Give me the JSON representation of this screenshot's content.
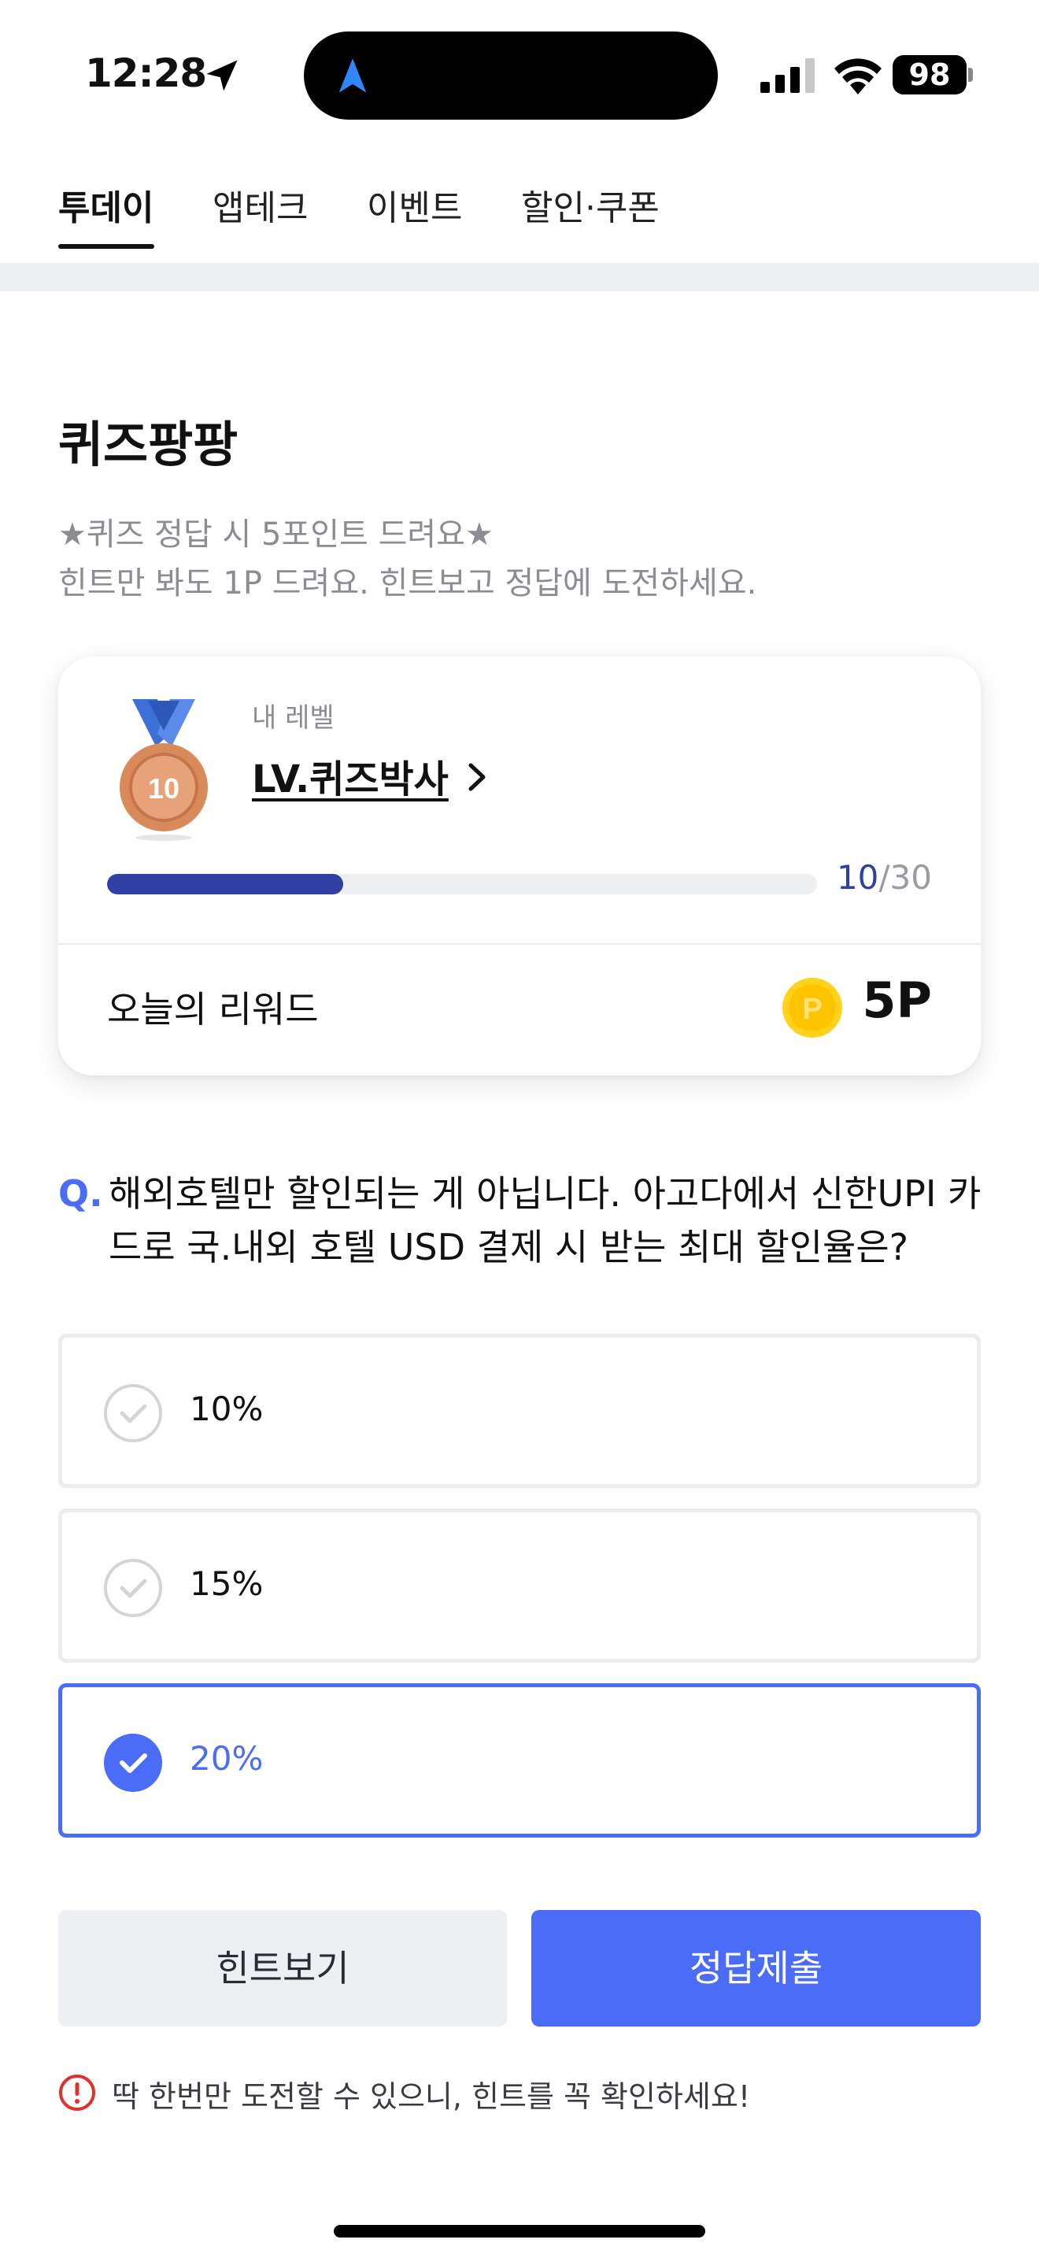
{
  "status_bar": {
    "time": "12:28",
    "battery": "98",
    "icons": [
      "location-arrow-icon",
      "navigation-icon",
      "cellular-signal-icon",
      "wifi-icon",
      "battery-icon"
    ]
  },
  "tabs": [
    {
      "label": "투데이",
      "active": true
    },
    {
      "label": "앱테크",
      "active": false
    },
    {
      "label": "이벤트",
      "active": false
    },
    {
      "label": "할인·쿠폰",
      "active": false
    }
  ],
  "quiz": {
    "title": "퀴즈팡팡",
    "desc_line1": "★퀴즈 정답 시 5포인트 드려요★",
    "desc_line2": "힌트만 봐도 1P 드려요. 힌트보고 정답에 도전하세요."
  },
  "level_card": {
    "label": "내 레벨",
    "name": "LV.퀴즈박사",
    "medal_number": "10",
    "progress_current": "10",
    "progress_separator": "/",
    "progress_total": "30",
    "progress_fraction": 0.333,
    "reward_label": "오늘의 리워드",
    "coin_letter": "P",
    "reward_value": "5P"
  },
  "question": {
    "prefix": "Q.",
    "text": "해외호텔만 할인되는 게 아닙니다. 아고다에서 신한UPI 카드로 국.내외 호텔 USD 결제 시 받는 최대 할인율은?"
  },
  "options": [
    {
      "label": "10%",
      "selected": false
    },
    {
      "label": "15%",
      "selected": false
    },
    {
      "label": "20%",
      "selected": true
    }
  ],
  "buttons": {
    "hint": "힌트보기",
    "submit": "정답제출"
  },
  "warning": "딱 한번만 도전할 수 있으니, 힌트를 꼭 확인하세요!",
  "colors": {
    "accent": "#4a6cf7",
    "progress": "#2f3fa4",
    "muted_text": "#8b8d93",
    "warning": "#e03131",
    "medal": "#d98a5a",
    "coin": "#ffd21e"
  }
}
